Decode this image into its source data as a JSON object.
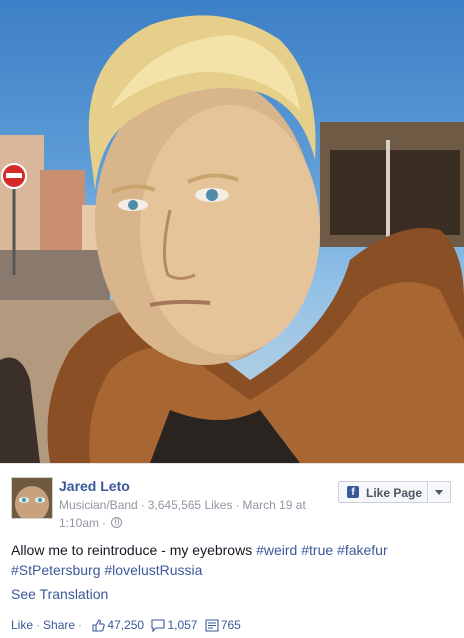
{
  "post": {
    "page_name": "Jared Leto",
    "category": "Musician/Band",
    "likes_count": "3,645,565 Likes",
    "date": "March 19 at",
    "time": "1:10am",
    "like_page_label": "Like Page",
    "status_prefix": "Allow me to reintroduce - my eyebrows",
    "hashtags_line1": [
      "#weird",
      "#true",
      "#fakefur"
    ],
    "hashtags_line2": [
      "#StPetersburg",
      "#lovelustRussia"
    ],
    "see_translation": "See Translation",
    "actions": {
      "like": "Like",
      "share": "Share",
      "like_count": "47,250",
      "comment_count": "1,057",
      "share_count": "765"
    }
  },
  "icons": [
    "thumbs-up-icon",
    "comment-icon",
    "share-icon",
    "globe-icon",
    "facebook-icon",
    "caret-down-icon"
  ],
  "colors": {
    "link": "#3b5998",
    "meta": "#9197a3",
    "text": "#141823"
  }
}
